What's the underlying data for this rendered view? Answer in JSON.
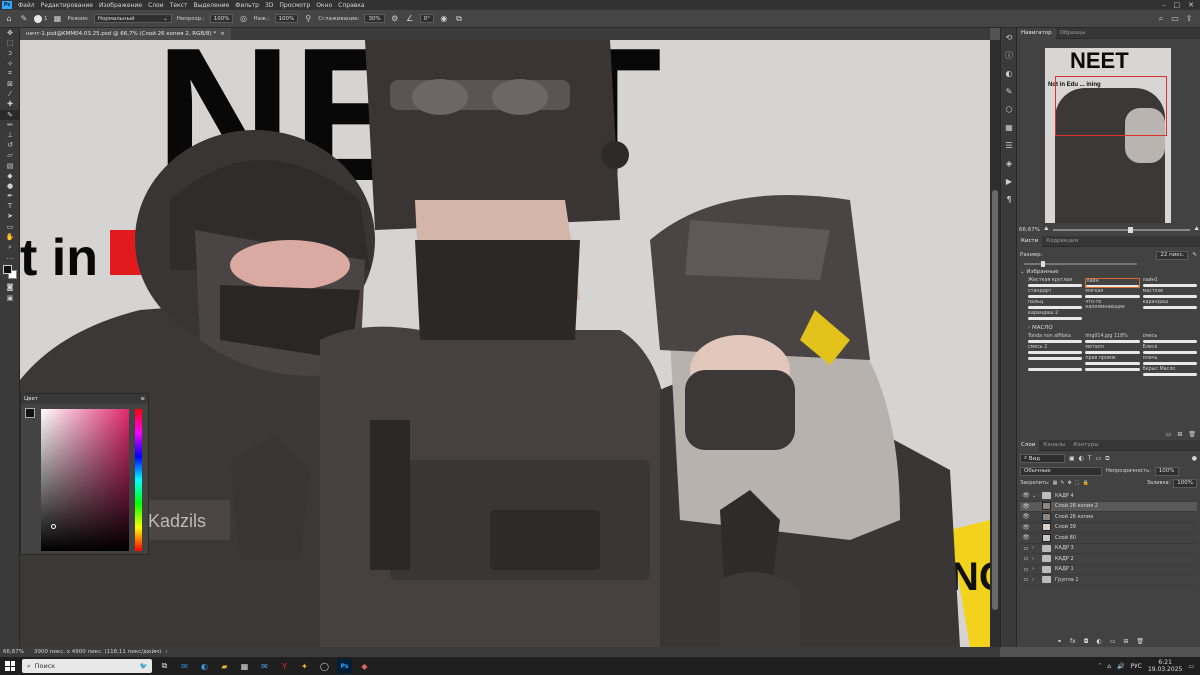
{
  "menubar": {
    "logo": "Ps",
    "items": [
      "Файл",
      "Редактирование",
      "Изображение",
      "Слои",
      "Текст",
      "Выделение",
      "Фильтр",
      "3D",
      "Просмотр",
      "Окно",
      "Справка"
    ]
  },
  "options": {
    "mode_label": "Режим:",
    "mode_value": "Нормальный",
    "opacity_label": "Непрозр.:",
    "opacity_value": "100%",
    "flow_label": "Наж.:",
    "flow_value": "100%",
    "smoothing_label": "Сглаживание:",
    "smoothing_value": "30%",
    "angle_value": "0°",
    "brush_size": "1"
  },
  "document": {
    "tab_title": "нечт-1.psd@KMM04.03.25.psd @ 66,7% (Слой 26 копия 2, RGB/8) *",
    "close": "×"
  },
  "artwork": {
    "title_text": "NEET",
    "subtitle_text": "t in Ed    ,       ming",
    "nametag": "Kadzils",
    "tape_text": "NG"
  },
  "color_panel": {
    "title": "Цвет"
  },
  "navigator": {
    "tabs": [
      "Навигатор",
      "Образцы"
    ],
    "zoom": "66,67%",
    "thumb_title": "NEET",
    "thumb_subtitle": "Not in Edu ... ining"
  },
  "brushes": {
    "tabs": [
      "Кисти",
      "Коррекция"
    ],
    "size_label": "Размер:",
    "size_value": "22 пикс.",
    "group1": "Избранные",
    "presets_row1": [
      "Жесткая круглая",
      "лайн",
      "лайн1"
    ],
    "presets_row2": [
      "стандарт",
      "мягкая",
      "мастхэв"
    ],
    "presets_row3": [
      "пальц",
      "что-то напоминающее",
      "карандаш"
    ],
    "presets_row4": [
      "карандаш 2"
    ],
    "group2": "МАСЛО",
    "presets_row5": [
      "Tonda non affilata",
      "img014.jpg 118%",
      "смесь"
    ],
    "presets_row6": [
      "смесь 2",
      "металл",
      "Блеск"
    ],
    "presets_row7": [
      "",
      "прав промж",
      "плечь"
    ],
    "presets_row8": [
      "",
      "",
      "бкрыс Масло"
    ]
  },
  "layers": {
    "tabs": [
      "Слои",
      "Каналы",
      "Контуры"
    ],
    "filter_label": "Вид",
    "blend_mode": "Обычные",
    "opacity_label": "Непрозрачность:",
    "opacity_value": "100%",
    "lock_label": "Закрепить:",
    "fill_label": "Заливка:",
    "fill_value": "100%",
    "items": [
      {
        "name": "КАДР 4",
        "type": "group",
        "visible": true
      },
      {
        "name": "Слой 26 копия 2",
        "type": "layer",
        "visible": true,
        "selected": true
      },
      {
        "name": "Слой 26 копия",
        "type": "layer",
        "visible": true
      },
      {
        "name": "Слой 39",
        "type": "layer",
        "visible": true
      },
      {
        "name": "Слой 80",
        "type": "layer",
        "visible": true
      },
      {
        "name": "КАДР 3",
        "type": "group",
        "visible": false
      },
      {
        "name": "КАДР 2",
        "type": "group",
        "visible": false
      },
      {
        "name": "КАДР 1",
        "type": "group",
        "visible": false
      },
      {
        "name": "Группа 1",
        "type": "group",
        "visible": false
      }
    ]
  },
  "status": {
    "zoom": "66,67%",
    "doc_info": "3900 пикс. x 4900 пикс. (118,11 пикс/дюйм)"
  },
  "taskbar": {
    "search_placeholder": "Поиск",
    "lang": "РУС",
    "time": "6:21",
    "date": "19.03.2025"
  },
  "colors": {
    "accent_red": "#e11b1b",
    "ps_blue": "#31a8ff",
    "tape_yellow": "#f2d21b"
  }
}
